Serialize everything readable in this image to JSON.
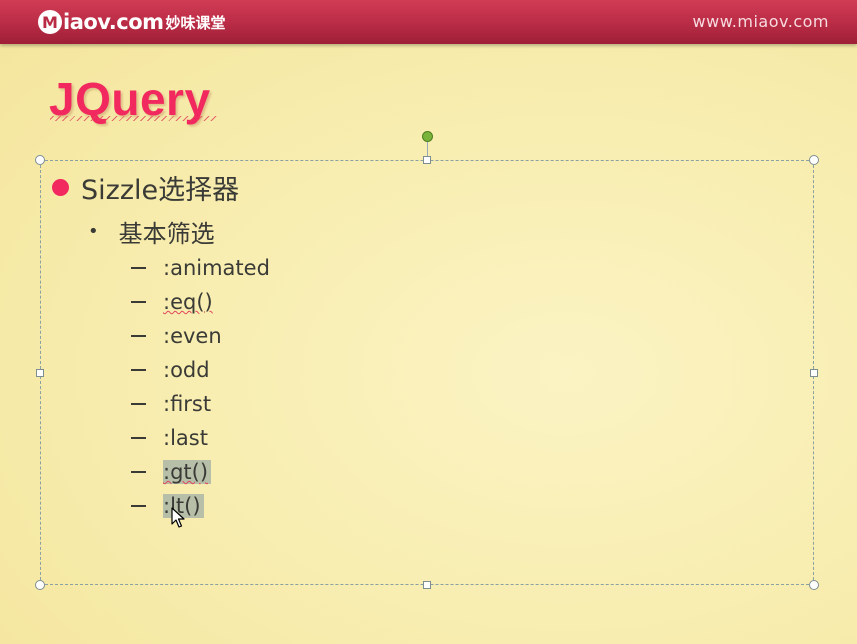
{
  "header": {
    "logo_badge": "M",
    "logo_domain": "iaov.com",
    "logo_cn": "妙味课堂",
    "site_url": "www.miaov.com"
  },
  "slide": {
    "title": "JQuery",
    "level1": "Sizzle选择器",
    "level2": "基本筛选",
    "items": [
      ":animated",
      ":eq()",
      ":even",
      ":odd",
      ":first",
      ":last",
      ":gt()",
      ":lt()"
    ],
    "highlighted_items": [
      ":gt()",
      ":lt()"
    ]
  },
  "colors": {
    "header": "#b92b45",
    "title": "#f2295e",
    "bullet": "#f2295e",
    "background": "#f8eeb2"
  }
}
